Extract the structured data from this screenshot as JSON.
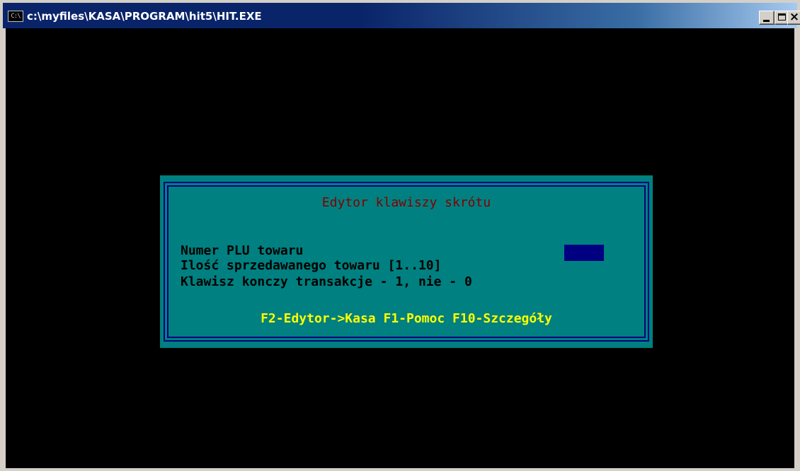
{
  "window": {
    "title": "c:\\myfiles\\KASA\\PROGRAM\\hit5\\HIT.EXE",
    "icon": "cmd-console-icon",
    "icon_text": "C:\\"
  },
  "dialog": {
    "title": "Edytor klawiszy skrótu",
    "fields": [
      {
        "label": "Numer PLU towaru",
        "value": ""
      },
      {
        "label": "Ilość sprzedawanego towaru [1..10]",
        "value": ""
      },
      {
        "label": "Klawisz konczy transakcje - 1, nie - 0",
        "value": ""
      }
    ],
    "hotkeys": "F2-Edytor->Kasa F1-Pomoc F10-Szczegóły"
  },
  "colors": {
    "console_bg": "#000000",
    "dialog_bg": "#008080",
    "frame": "#000080",
    "title_text": "#800000",
    "label_text": "#000000",
    "hotkey_text": "#ffff00",
    "input_bg": "#000080"
  }
}
